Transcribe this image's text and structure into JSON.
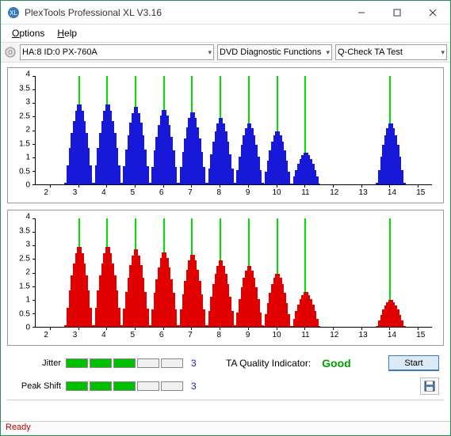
{
  "window": {
    "title": "PlexTools Professional XL V3.16"
  },
  "menu": {
    "options": "Options",
    "help": "Help"
  },
  "toolbar": {
    "drive": "HA:8 ID:0   PX-760A",
    "func": "DVD Diagnostic Functions",
    "test": "Q-Check TA Test"
  },
  "chart_data": [
    {
      "type": "bar",
      "color": "#1818d8",
      "xlim": [
        1.5,
        15.5
      ],
      "ylim": [
        0,
        4
      ],
      "xticks": [
        2,
        3,
        4,
        5,
        6,
        7,
        8,
        9,
        10,
        11,
        12,
        13,
        14,
        15
      ],
      "yticks": [
        0,
        0.5,
        1,
        1.5,
        2,
        2.5,
        3,
        3.5,
        4
      ],
      "gridlines": [
        3,
        4,
        5,
        6,
        7,
        8,
        9,
        10,
        11,
        14
      ],
      "clusters": [
        {
          "center": 3,
          "peak": 3.0
        },
        {
          "center": 4,
          "peak": 3.0
        },
        {
          "center": 5,
          "peak": 2.9
        },
        {
          "center": 6,
          "peak": 2.8
        },
        {
          "center": 7,
          "peak": 2.7
        },
        {
          "center": 8,
          "peak": 2.5
        },
        {
          "center": 9,
          "peak": 2.3
        },
        {
          "center": 10,
          "peak": 2.0
        },
        {
          "center": 11,
          "peak": 1.2
        },
        {
          "center": 14,
          "peak": 2.3
        }
      ]
    },
    {
      "type": "bar",
      "color": "#e00000",
      "xlim": [
        1.5,
        15.5
      ],
      "ylim": [
        0,
        4
      ],
      "xticks": [
        2,
        3,
        4,
        5,
        6,
        7,
        8,
        9,
        10,
        11,
        12,
        13,
        14,
        15
      ],
      "yticks": [
        0,
        0.5,
        1,
        1.5,
        2,
        2.5,
        3,
        3.5,
        4
      ],
      "gridlines": [
        3,
        4,
        5,
        6,
        7,
        8,
        9,
        10,
        11,
        14
      ],
      "clusters": [
        {
          "center": 3,
          "peak": 3.0
        },
        {
          "center": 4,
          "peak": 3.0
        },
        {
          "center": 5,
          "peak": 2.9
        },
        {
          "center": 6,
          "peak": 2.8
        },
        {
          "center": 7,
          "peak": 2.7
        },
        {
          "center": 8,
          "peak": 2.5
        },
        {
          "center": 9,
          "peak": 2.3
        },
        {
          "center": 10,
          "peak": 2.0
        },
        {
          "center": 11,
          "peak": 1.3
        },
        {
          "center": 14,
          "peak": 1.0
        }
      ]
    }
  ],
  "stats": {
    "jitter_label": "Jitter",
    "jitter_value": "3",
    "jitter_filled": 3,
    "peakshift_label": "Peak Shift",
    "peakshift_value": "3",
    "peakshift_filled": 3,
    "qi_label": "TA Quality Indicator:",
    "qi_value": "Good",
    "start": "Start"
  },
  "status": "Ready"
}
